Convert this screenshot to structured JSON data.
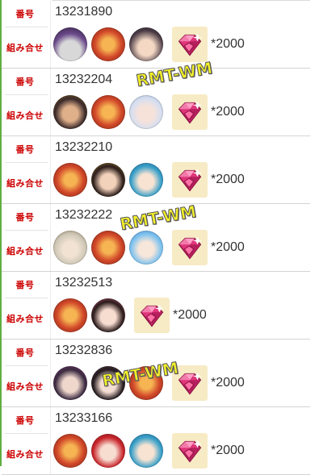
{
  "labels": {
    "number": "番号",
    "combination": "組み合せ"
  },
  "entries": [
    {
      "id": "13231890",
      "quantity": "*2000",
      "avatars": [
        "witch-old-character",
        "dragon-armor-character",
        "twin-tail-girl-character"
      ]
    },
    {
      "id": "13232204",
      "quantity": "*2000",
      "avatars": [
        "warlord-character",
        "dragon-armor-character",
        "fox-ear-girl-character"
      ]
    },
    {
      "id": "13232210",
      "quantity": "*2000",
      "avatars": [
        "dragon-armor-character",
        "princess-character",
        "blue-girl-character"
      ]
    },
    {
      "id": "13232222",
      "quantity": "*2000",
      "avatars": [
        "old-sage-character",
        "dragon-armor-character",
        "blue-hair-girl-character"
      ]
    },
    {
      "id": "13232513",
      "quantity": "*2000",
      "avatars": [
        "dragon-armor-character",
        "pink-girl-character"
      ]
    },
    {
      "id": "13232836",
      "quantity": "*2000",
      "avatars": [
        "dark-horned-character",
        "dark-hair-girl-character",
        "dragon-armor-character"
      ]
    },
    {
      "id": "13233166",
      "quantity": "*2000",
      "avatars": [
        "dragon-armor-character",
        "red-devil-girl-character",
        "blue-girl-character"
      ]
    }
  ],
  "watermark": "RMT-WM",
  "colors": {
    "label_red": "#cc0000",
    "gem_bg": "#f7ebc5",
    "gem_pink": "#e0357a",
    "border_green": "#5fae3f",
    "watermark_yellow": "#f2ef2a"
  }
}
